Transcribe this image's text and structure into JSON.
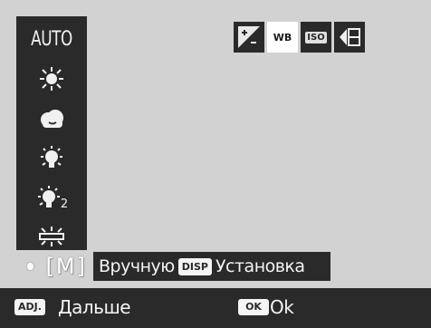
{
  "wb_menu": {
    "auto_label": "AUTO",
    "items": [
      {
        "icon": "sun-icon"
      },
      {
        "icon": "cloud-icon"
      },
      {
        "icon": "bulb-icon"
      },
      {
        "icon": "bulb-2-icon",
        "suffix": "2"
      },
      {
        "icon": "fluorescent-icon"
      }
    ],
    "manual_short": "[M]",
    "manual_label": "Вручную",
    "disp_label": "DISP",
    "set_label": "Установка"
  },
  "tabs": [
    {
      "icon": "exposure-compensation-icon"
    },
    {
      "label": "WB",
      "active": true
    },
    {
      "label": "ISO"
    },
    {
      "icon": "image-quality-icon"
    }
  ],
  "bottom_bar": {
    "adj_label": "ADJ.",
    "next_label": "Дальше",
    "ok_badge": "OK",
    "ok_label": "Ok"
  },
  "colors": {
    "background": "#d2d2d2",
    "panel": "#2a2a2a",
    "text": "#f4f4f4"
  }
}
